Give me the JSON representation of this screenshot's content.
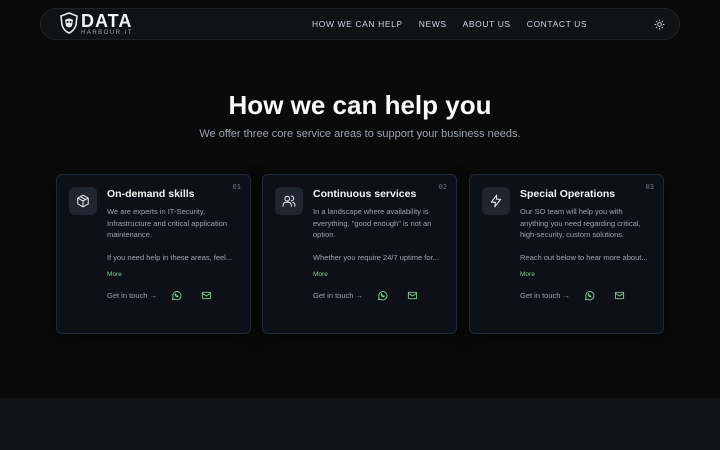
{
  "brand": {
    "name": "DATA",
    "tagline": "HARBOUR IT"
  },
  "nav": {
    "items": [
      "HOW WE CAN HELP",
      "NEWS",
      "ABOUT US",
      "CONTACT US"
    ],
    "theme_toggle_icon": "sun-icon"
  },
  "hero": {
    "title": "How we can help you",
    "subtitle": "We offer three core service areas to support your business needs."
  },
  "cards": [
    {
      "number": "01",
      "icon": "box-icon",
      "title": "On-demand skills",
      "description": "We are experts in IT-Security, Infrastructure and critical application maintenance.",
      "more_text": "If you need help in these areas, feel...",
      "more_label": "More",
      "cta": "Get in touch →"
    },
    {
      "number": "02",
      "icon": "users-icon",
      "title": "Continuous services",
      "description": "In a landscape where availability is everything, \"good enough\" is not an option.",
      "more_text": "Whether you require 24/7 uptime for...",
      "more_label": "More",
      "cta": "Get in touch →"
    },
    {
      "number": "03",
      "icon": "lightning-icon",
      "title": "Special Operations",
      "description": "Our SO team will help you with anything you need regarding critical, high-security, custom solutions.",
      "more_text": "Reach out below to hear more about...",
      "more_label": "More",
      "cta": "Get in touch →"
    }
  ],
  "colors": {
    "background": "#0a0a0b",
    "card": "#0d1117",
    "accent_green": "#86c89a",
    "muted": "#9ca3af"
  }
}
